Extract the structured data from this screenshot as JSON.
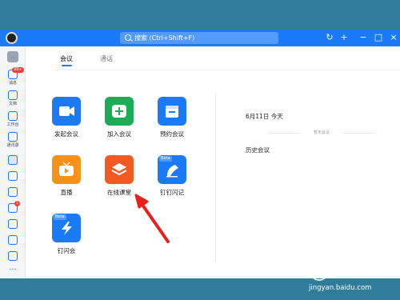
{
  "titlebar": {
    "search_placeholder": "搜索 (Ctrl+Shift+F)",
    "history_icon": "↻",
    "add_icon": "+",
    "minimize_icon": "−",
    "maximize_icon": "□",
    "close_icon": "×"
  },
  "sidebar": {
    "items": [
      {
        "label": "消息",
        "badge": "99+"
      },
      {
        "label": "文档"
      },
      {
        "label": "工作台"
      },
      {
        "label": "通讯录"
      },
      {
        "label": ""
      },
      {
        "label": ""
      },
      {
        "label": ""
      },
      {
        "label": "",
        "badge": "1"
      },
      {
        "label": ""
      },
      {
        "label": ""
      },
      {
        "label": ""
      },
      {
        "label": ""
      }
    ]
  },
  "tabs": {
    "active": "会议",
    "second": "通话"
  },
  "tiles": [
    {
      "label": "发起会议",
      "color": "#1a7af8",
      "icon": "video-camera-icon"
    },
    {
      "label": "加入会议",
      "color": "#1aad55",
      "icon": "plus-icon"
    },
    {
      "label": "预约会议",
      "color": "#1a7af8",
      "icon": "calendar-icon"
    },
    {
      "label": "直播",
      "color": "#f7911a",
      "icon": "tv-icon"
    },
    {
      "label": "在线课堂",
      "color": "#f25a24",
      "icon": "layers-icon"
    },
    {
      "label": "钉钉闪记",
      "color": "#1a7af8",
      "icon": "pen-icon",
      "beta": "Beta"
    },
    {
      "label": "钉闪会",
      "color": "#1a7af8",
      "icon": "lightning-icon",
      "beta": "Beta"
    }
  ],
  "schedule": {
    "date": "6月11日 今天",
    "empty": "暂无会议",
    "history": "历史会议"
  },
  "watermark": {
    "text": "jingyan.baidu.com"
  }
}
